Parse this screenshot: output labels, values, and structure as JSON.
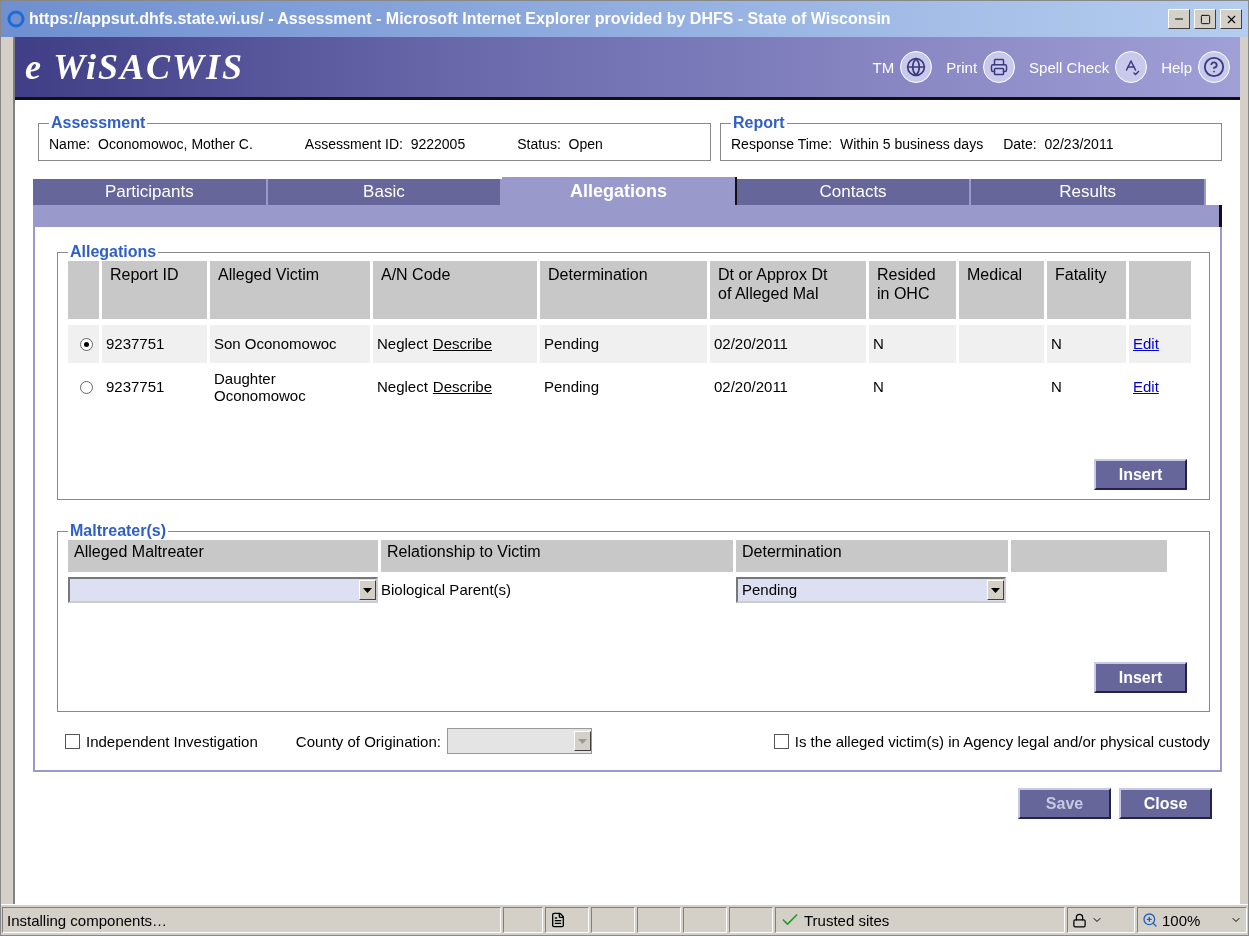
{
  "window": {
    "title": "https://appsut.dhfs.state.wi.us/ - Assessment - Microsoft Internet Explorer provided by DHFS - State of Wisconsin"
  },
  "header": {
    "logo": "e WiSACWIS",
    "tools": [
      {
        "label": "TM",
        "kind": "globe"
      },
      {
        "label": "Print",
        "kind": "printer"
      },
      {
        "label": "Spell Check",
        "kind": "spellcheck"
      },
      {
        "label": "Help",
        "kind": "help"
      }
    ]
  },
  "assessment": {
    "legend": "Assessment",
    "fields": [
      {
        "label": "Name:",
        "value": "Oconomowoc, Mother C."
      },
      {
        "label": "Assessment ID:",
        "value": "9222005"
      },
      {
        "label": "Status:",
        "value": "Open"
      }
    ]
  },
  "report": {
    "legend": "Report",
    "fields": [
      {
        "label": "Response Time:",
        "value": "Within 5 business days"
      },
      {
        "label": "Date:",
        "value": "02/23/2011"
      }
    ]
  },
  "tabs": [
    {
      "label": "Participants",
      "selected": false
    },
    {
      "label": "Basic",
      "selected": false
    },
    {
      "label": "Allegations",
      "selected": true
    },
    {
      "label": "Contacts",
      "selected": false
    },
    {
      "label": "Results",
      "selected": false
    }
  ],
  "allegations": {
    "legend": "Allegations",
    "columns": [
      "Report ID",
      "Alleged Victim",
      "A/N Code",
      "Determination",
      "Dt or Approx Dt\nof Alleged Mal",
      "Resided\nin OHC",
      "Medical",
      "Fatality"
    ],
    "rows": [
      {
        "selected": true,
        "report_id": "9237751",
        "victim": "Son Oconomowoc",
        "an_code": "Neglect",
        "describe": "Describe",
        "determination": "Pending",
        "date": "02/20/2011",
        "resided": "N",
        "fatality": "N",
        "edit": "Edit"
      },
      {
        "selected": false,
        "report_id": "9237751",
        "victim": "Daughter\nOconomowoc",
        "an_code": "Neglect",
        "describe": "Describe",
        "determination": "Pending",
        "date": "02/20/2011",
        "resided": "N",
        "fatality": "N",
        "edit": "Edit"
      }
    ],
    "insert": {
      "label": "Insert"
    }
  },
  "maltreaters": {
    "legend": "Maltreater(s)",
    "columns": [
      "Alleged Maltreater",
      "Relationship to Victim",
      "Determination"
    ],
    "rows": [
      {
        "relationship": "Biological Parent(s)",
        "determination": "Pending"
      }
    ],
    "insert": {
      "label": "Insert"
    }
  },
  "options": {
    "independent": {
      "label": "Independent Investigation",
      "checked": false
    },
    "county": {
      "label": "County of Origination:",
      "disabled": true
    },
    "custody": {
      "label": "Is the alleged victim(s) in Agency legal and/or physical custody",
      "checked": false
    }
  },
  "buttons": [
    {
      "label": "Save",
      "disabled": true
    },
    {
      "label": "Close",
      "disabled": false
    }
  ],
  "status_bar": {
    "text": "Installing components…",
    "zone": "Trusted sites",
    "zoom": "100%"
  }
}
